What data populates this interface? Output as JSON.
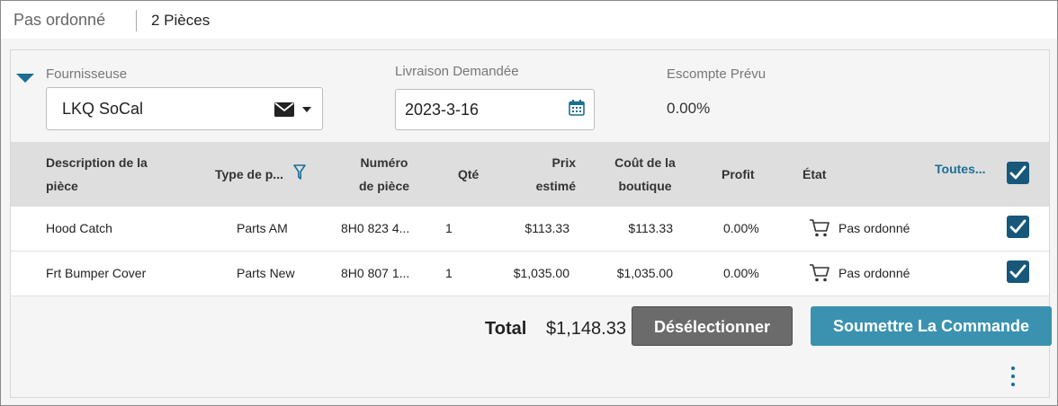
{
  "header": {
    "status": "Pas ordonné",
    "count": "2 Pièces"
  },
  "form": {
    "supplier_label": "Fournisseuse",
    "supplier_value": "LKQ SoCal",
    "delivery_label": "Livraison Demandée",
    "delivery_value": "2023-3-16",
    "discount_label": "Escompte Prévu",
    "discount_value": "0.00%"
  },
  "table": {
    "headers": {
      "description": [
        "Description de la",
        "pièce"
      ],
      "type": "Type de p...",
      "number": [
        "Numéro",
        "de pièce"
      ],
      "qty": "Qté",
      "price": [
        "Prix",
        "estimé"
      ],
      "cost": [
        "Coût de la",
        "boutique"
      ],
      "profit": "Profit",
      "state": "État",
      "all": "Toutes..."
    },
    "rows": [
      {
        "description": "Hood Catch",
        "type": "Parts AM",
        "number": "8H0 823 4...",
        "qty": "1",
        "price": "$113.33",
        "cost": "$113.33",
        "profit": "0.00%",
        "state": "Pas ordonné"
      },
      {
        "description": "Frt Bumper Cover",
        "type": "Parts New",
        "number": "8H0 807 1...",
        "qty": "1",
        "price": "$1,035.00",
        "cost": "$1,035.00",
        "profit": "0.00%",
        "state": "Pas ordonné"
      }
    ]
  },
  "footer": {
    "total_label": "Total",
    "total_value": "$1,148.33",
    "deselect_label": "Désélectionner",
    "submit_label": "Soumettre La Commande"
  },
  "icons": {
    "collapse": "triangle-down-icon",
    "mail": "envelope-icon",
    "dropdown": "caret-down-icon",
    "calendar": "calendar-icon",
    "filter": "funnel-icon",
    "checkbox": "checkbox-checked-icon",
    "cart": "cart-icon",
    "more": "kebab-menu-icon"
  },
  "colors": {
    "accent": "#1b6e94",
    "checkbox": "#17587a",
    "submit": "#3a92b0",
    "deselect": "#6b6b6b"
  }
}
